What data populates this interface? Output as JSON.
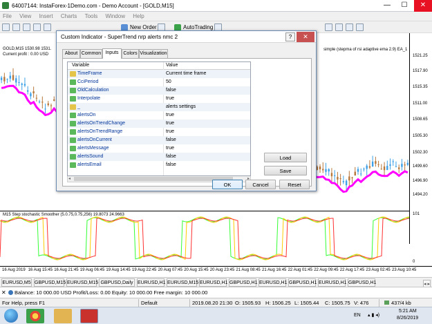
{
  "window": {
    "title": "64007144: InstaForex-1Demo.com - Demo Account - [GOLD,M15]",
    "minimize": "—",
    "maximize": "☐",
    "close": "✕"
  },
  "menu": [
    "File",
    "View",
    "Insert",
    "Charts",
    "Tools",
    "Window",
    "Help"
  ],
  "toolbar": {
    "new_order": "New Order",
    "autotrading": "AutoTrading"
  },
  "chart": {
    "symbol_label": "GOLD,M15  1530.98 1531.",
    "profit_label": "Current profit : 0.00 USD",
    "ea_label": "simple (stepma of rsi adaptive ema 2.9) EA_1",
    "sub_label": "M15 Step stochastic Smoother (5.0.75,0.75,256) 19.8073 24.9663",
    "price_ticks": [
      "1521.25",
      "1517.90",
      "1515.35",
      "1511.00",
      "1508.65",
      "1505.30",
      "1502.30",
      "1499.60",
      "1496.90",
      "1494.20",
      "101",
      "0"
    ],
    "time_ticks": [
      "16 Aug 2019",
      "16 Aug 15:45",
      "16 Aug 21:45",
      "19 Aug 06:45",
      "19 Aug 14:45",
      "19 Aug 22:45",
      "20 Aug 07:45",
      "20 Aug 15:45",
      "20 Aug 23:45",
      "21 Aug 08:45",
      "21 Aug 16:45",
      "22 Aug 01:45",
      "22 Aug 09:45",
      "22 Aug 17:45",
      "23 Aug 02:45",
      "23 Aug 10:45"
    ],
    "colors": {
      "bull_candle": "#3da0e8",
      "bear_candle": "#b8773a",
      "supertrend_up": "#ff00ff",
      "supertrend_dn": "#ffffff",
      "stoch_main": "#ff3030",
      "stoch_signal": "#33ff33",
      "stoch_third": "#ffcc00"
    }
  },
  "symbol_tabs": [
    "EURUSD,M5",
    "GBPUSD,M15",
    "EURUSD,M15",
    "GBPUSD,Daily",
    "EURUSD,H1",
    "EURUSD,M15",
    "EURUSD,H1",
    "GBPUSD,H1",
    "EURUSD,H1",
    "GBPUSD,H1",
    "EURUSD,H1",
    "GBPUSD,H1"
  ],
  "terminal": {
    "text": "Balance: 10 000.00 USD  Profit/Loss: 0.00  Equity: 10 000.00  Free margin: 10 000.00"
  },
  "status": {
    "help": "For Help, press F1",
    "profile": "Default",
    "datetime": "2019.08.20 21:30",
    "open": "O: 1505.93",
    "high": "H: 1506.25",
    "low": "L: 1505.44",
    "close": "C: 1505.75",
    "volume": "V: 476",
    "traffic": "437/4 kb"
  },
  "taskbar": {
    "lang": "EN",
    "time": "5:21 AM",
    "date": "8/26/2019"
  },
  "dialog": {
    "title": "Custom Indicator - SuperTrend nrp alerts nmc 2",
    "help": "?",
    "close": "✕",
    "tabs": [
      "About",
      "Common",
      "Inputs",
      "Colors",
      "Visualization"
    ],
    "active_tab": "Inputs",
    "col_variable": "Variable",
    "col_value": "Value",
    "rows": [
      {
        "icon": "ab",
        "name": "TimeFrame",
        "value": "Current time frame"
      },
      {
        "icon": "num",
        "name": "CciPeriod",
        "value": "50"
      },
      {
        "icon": "num",
        "name": "OldCalculation",
        "value": "false"
      },
      {
        "icon": "num",
        "name": "Interpolate",
        "value": "true"
      },
      {
        "icon": "ab",
        "name": "_",
        "value": "alerts settings"
      },
      {
        "icon": "num",
        "name": "alertsOn",
        "value": "true"
      },
      {
        "icon": "num",
        "name": "alertsOnTrendChange",
        "value": "true"
      },
      {
        "icon": "num",
        "name": "alertsOnTrendRange",
        "value": "true"
      },
      {
        "icon": "num",
        "name": "alertsOnCurrent",
        "value": "false"
      },
      {
        "icon": "num",
        "name": "alertsMessage",
        "value": "true"
      },
      {
        "icon": "num",
        "name": "alertsSound",
        "value": "false"
      },
      {
        "icon": "num",
        "name": "alertsEmail",
        "value": "false"
      }
    ],
    "load": "Load",
    "save": "Save",
    "ok": "OK",
    "cancel": "Cancel",
    "reset": "Reset"
  }
}
